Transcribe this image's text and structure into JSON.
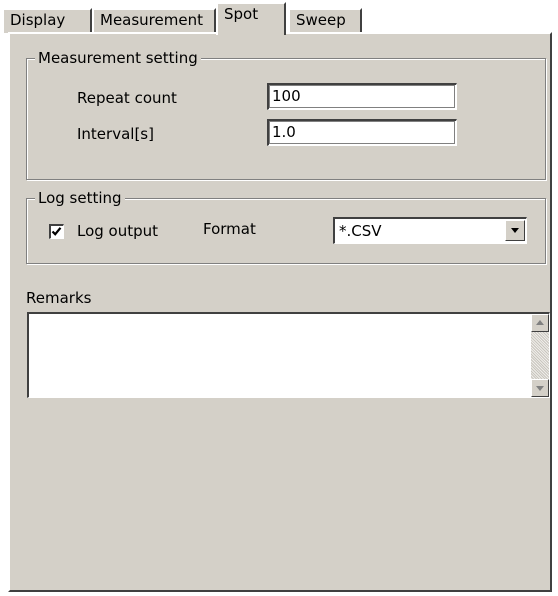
{
  "tabs": [
    {
      "label": "Display",
      "active": false
    },
    {
      "label": "Measurement",
      "active": false
    },
    {
      "label": "Spot",
      "active": true
    },
    {
      "label": "Sweep",
      "active": false
    }
  ],
  "measurement_setting": {
    "title": "Measurement setting",
    "repeat_count_label": "Repeat count",
    "repeat_count_value": "100",
    "interval_label": "Interval[s]",
    "interval_value": "1.0"
  },
  "log_setting": {
    "title": "Log setting",
    "log_output_label": "Log output",
    "log_output_checked": true,
    "format_label": "Format",
    "format_value": "*.CSV"
  },
  "remarks": {
    "label": "Remarks",
    "value": ""
  },
  "icons": {
    "checkbox_check": "check-icon",
    "combo_arrow": "triangle-down-icon",
    "scroll_up": "triangle-up-icon",
    "scroll_down": "triangle-down-icon"
  },
  "colors": {
    "face": "#d4d0c8",
    "field": "#ffffff"
  }
}
